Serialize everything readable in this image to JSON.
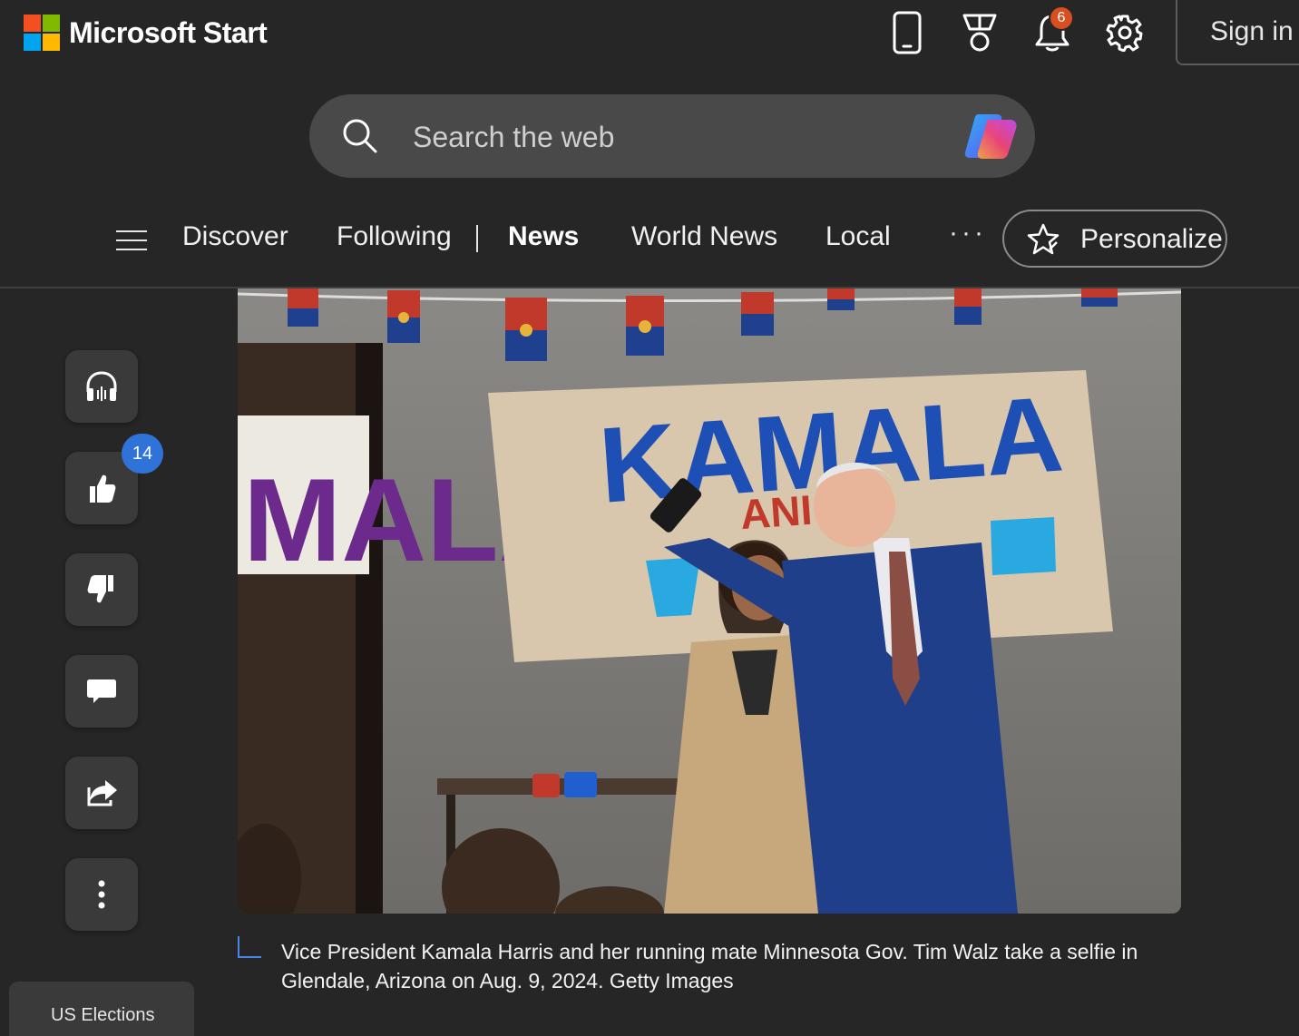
{
  "header": {
    "brand": "Microsoft Start",
    "notification_count": "6",
    "sign_in_label": "Sign in",
    "icons": [
      "phone-icon",
      "rewards-icon",
      "bell-icon",
      "settings-icon"
    ]
  },
  "search": {
    "placeholder": "Search the web"
  },
  "nav": {
    "items": [
      {
        "label": "Discover"
      },
      {
        "label": "Following"
      },
      {
        "label": "News",
        "active": true
      },
      {
        "label": "World News"
      },
      {
        "label": "Local"
      }
    ],
    "more_label": "···",
    "personalize_label": "Personalize"
  },
  "rail": {
    "like_count": "14",
    "actions": [
      "listen-icon",
      "like-icon",
      "dislike-icon",
      "comment-icon",
      "share-icon",
      "more-vertical-icon"
    ]
  },
  "article": {
    "photo_texts": {
      "sign_main": "KAMALA",
      "sign_small": "ANI",
      "side_poster": "MALA"
    },
    "caption": "Vice President Kamala Harris and her running mate Minnesota Gov. Tim Walz take a selfie in Glendale, Arizona on Aug. 9, 2024. Getty Images"
  },
  "bottom_card": {
    "label": "US Elections"
  },
  "colors": {
    "background": "#262626",
    "accent_blue": "#2f73d9",
    "notification": "#d84f1f"
  }
}
